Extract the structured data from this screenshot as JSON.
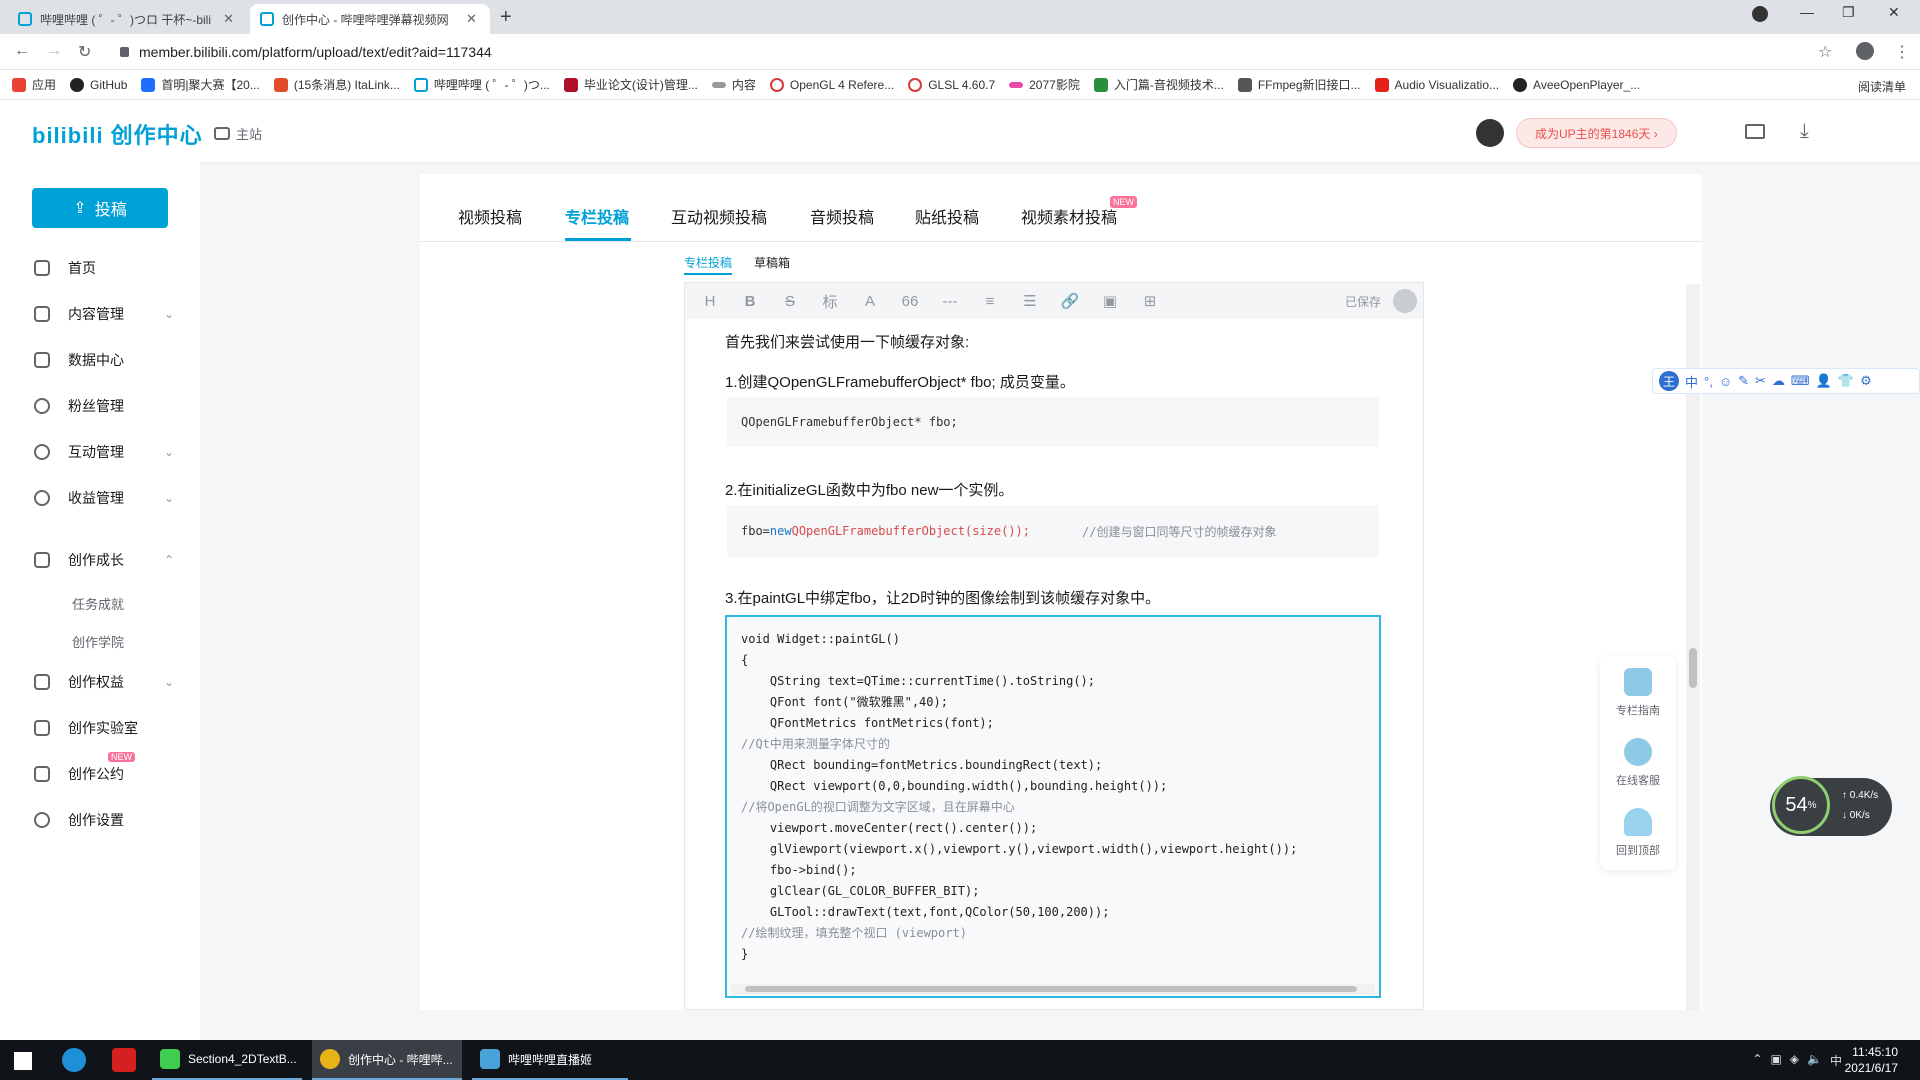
{
  "browser": {
    "tabs": [
      {
        "title": "哔哩哔哩 ( ゜- ゜)つロ 干杯~-bili",
        "active": false
      },
      {
        "title": "创作中心 - 哔哩哔哩弹幕视频网",
        "active": true
      }
    ],
    "new_tab": "+",
    "url": "member.bilibili.com/platform/upload/text/edit?aid=117344",
    "bookmarks": [
      "应用",
      "GitHub",
      "首明|聚大赛【20...",
      "(15条消息) ItaLink...",
      "哔哩哔哩 ( ゜- ゜)つ...",
      "毕业论文(设计)管理...",
      "内容",
      "OpenGL 4 Refere...",
      "GLSL 4.60.7",
      "2077影院",
      "入门篇-音视频技术...",
      "FFmpeg新旧接口...",
      "Audio Visualizatio...",
      "AveeOpenPlayer_..."
    ],
    "reading_list": "阅读清单"
  },
  "header": {
    "logo": "bilibili 创作中心",
    "main_site": "主站",
    "up_badge": "成为UP主的第1846天 ›"
  },
  "sidebar": {
    "post_button": "投稿",
    "items": [
      {
        "label": "首页",
        "arrow": ""
      },
      {
        "label": "内容管理",
        "arrow": "⌄"
      },
      {
        "label": "数据中心",
        "arrow": ""
      },
      {
        "label": "粉丝管理",
        "arrow": ""
      },
      {
        "label": "互动管理",
        "arrow": "⌄"
      },
      {
        "label": "收益管理",
        "arrow": "⌄"
      },
      {
        "label": "创作成长",
        "arrow": "⌃"
      },
      {
        "label": "创作权益",
        "arrow": "⌄"
      },
      {
        "label": "创作实验室",
        "arrow": ""
      },
      {
        "label": "创作公约",
        "arrow": ""
      },
      {
        "label": "创作设置",
        "arrow": ""
      }
    ],
    "sub_items": [
      "任务成就",
      "创作学院"
    ],
    "new_tag": "NEW"
  },
  "main": {
    "tabs": [
      "视频投稿",
      "专栏投稿",
      "互动视频投稿",
      "音频投稿",
      "贴纸投稿",
      "视频素材投稿"
    ],
    "tab_new": "NEW",
    "subtabs": [
      "专栏投稿",
      "草稿箱"
    ],
    "toolbar": {
      "buttons": [
        "H",
        "B",
        "S",
        "标",
        "A",
        "66",
        "---",
        "≡",
        "☰",
        "🔗",
        "▣",
        "⊞"
      ],
      "saved": "已保存"
    },
    "content": {
      "p1": "首先我们来尝试使用一下帧缓存对象:",
      "p2": "1.创建QOpenGLFramebufferObject* fbo; 成员变量。",
      "code1": "QOpenGLFramebufferObject* fbo;",
      "p3": "2.在initializeGL函数中为fbo new一个实例。",
      "code2_a": "fbo=",
      "code2_b": "new",
      "code2_c": " QOpenGLFramebufferObject(size());",
      "code2_comment": "//创建与窗口同等尺寸的帧缓存对象",
      "p4": "3.在paintGL中绑定fbo，让2D时钟的图像绘制到该帧缓存对象中。",
      "code3": [
        "void Widget::paintGL()",
        "{",
        "    QString text=QTime::currentTime().toString();",
        "    QFont font(\"微软雅黑\",40);",
        "    QFontMetrics fontMetrics(font);",
        "//Qt中用来测量字体尺寸的",
        "    QRect bounding=fontMetrics.boundingRect(text);",
        "    QRect viewport(0,0,bounding.width(),bounding.height());",
        "//将OpenGL的视口调整为文字区域，且在屏幕中心",
        "    viewport.moveCenter(rect().center());",
        "    glViewport(viewport.x(),viewport.y(),viewport.width(),viewport.height());",
        "    fbo->bind();",
        "    glClear(GL_COLOR_BUFFER_BIT);",
        "    GLTool::drawText(text,font,QColor(50,100,200));",
        "//绘制纹理，填充整个视口 (viewport)",
        "}"
      ]
    }
  },
  "ime_bar": {
    "logo": "王",
    "items": [
      "中",
      "°,",
      "☺",
      "✎",
      "✂",
      "☁",
      "⌨",
      "👤",
      "👕",
      "⚙"
    ]
  },
  "helper": {
    "guide": "专栏指南",
    "service": "在线客服",
    "top": "回到顶部"
  },
  "speed": {
    "percent": "54",
    "unit": "%",
    "up": "0.4",
    "down": "0",
    "rate_unit": "K/s"
  },
  "taskbar": {
    "tasks": [
      {
        "label": "Section4_2DTextB..."
      },
      {
        "label": "创作中心 - 哔哩哔..."
      },
      {
        "label": "哔哩哔哩直播姬"
      }
    ],
    "ime": "中",
    "time": "11:45:10",
    "date": "2021/6/17"
  }
}
